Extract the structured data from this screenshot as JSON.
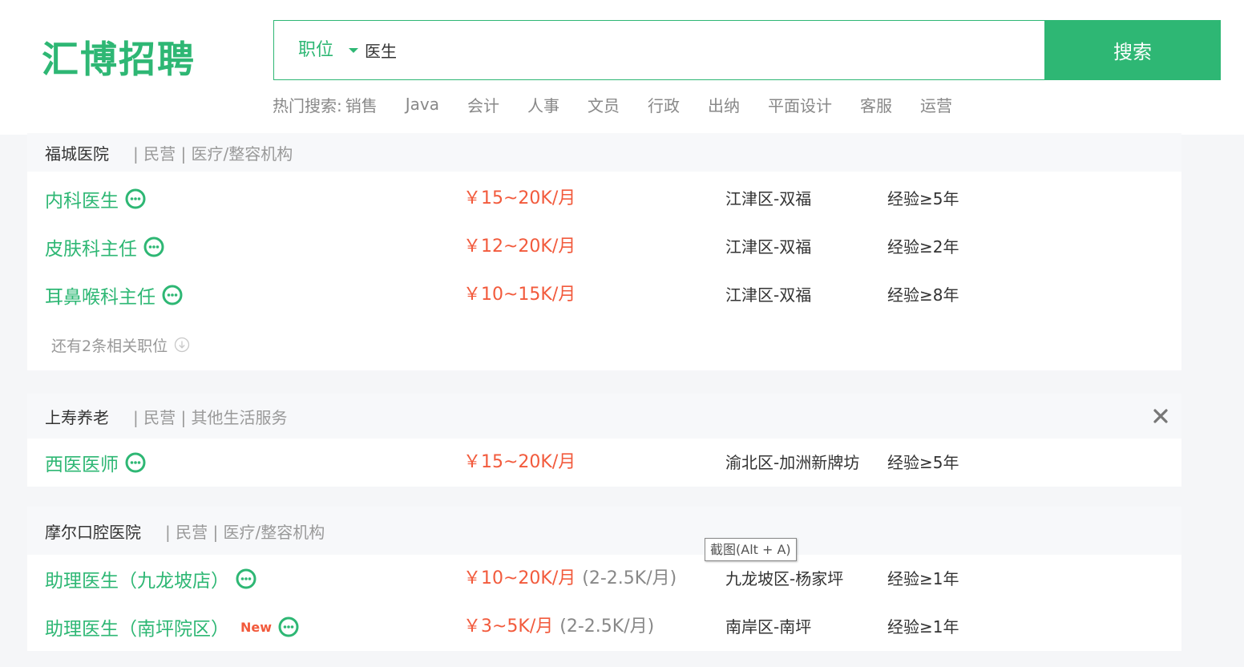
{
  "header": {
    "logo": "汇博招聘",
    "search": {
      "type_label": "职位",
      "query": "医生",
      "button_label": "搜索"
    },
    "hot_search": {
      "label": "热门搜索:",
      "items": [
        "销售",
        "Java",
        "会计",
        "人事",
        "文员",
        "行政",
        "出纳",
        "平面设计",
        "客服",
        "运营"
      ]
    }
  },
  "companies": [
    {
      "name": "福城医院",
      "meta": "| 民营 | 医疗/整容机构",
      "jobs": [
        {
          "title": "内科医生",
          "salary": "￥15~20K/月",
          "location": "江津区-双福",
          "experience": "经验≥5年"
        },
        {
          "title": "皮肤科主任",
          "salary": "￥12~20K/月",
          "location": "江津区-双福",
          "experience": "经验≥2年"
        },
        {
          "title": "耳鼻喉科主任",
          "salary": "￥10~15K/月",
          "location": "江津区-双福",
          "experience": "经验≥8年"
        }
      ],
      "more_jobs": "还有2条相关职位"
    },
    {
      "name": "上寿养老",
      "meta": "| 民营 | 其他生活服务",
      "jobs": [
        {
          "title": "西医医师",
          "salary": "￥15~20K/月",
          "location": "渝北区-加洲新牌坊",
          "experience": "经验≥5年"
        }
      ]
    },
    {
      "name": "摩尔口腔医院",
      "meta": "| 民营 | 医疗/整容机构",
      "jobs": [
        {
          "title": "助理医生（九龙坡店）",
          "salary": "￥10~20K/月",
          "salary_extra": "(2-2.5K/月)",
          "location": "九龙坡区-杨家坪",
          "experience": "经验≥1年"
        },
        {
          "title": "助理医生（南坪院区）",
          "badge": "New",
          "salary": "￥3~5K/月",
          "salary_extra": "(2-2.5K/月)",
          "location": "南岸区-南坪",
          "experience": "经验≥1年"
        }
      ]
    }
  ],
  "tooltip": "截图(Alt + A)",
  "icons": {
    "chat": "chat-bubble-icon",
    "close": "close-icon",
    "more": "down-circle-icon",
    "caret": "caret-down-icon"
  },
  "colors": {
    "brand_green": "#2eb774",
    "salary_red": "#f25a3c",
    "new_badge": "#f25a3c"
  }
}
